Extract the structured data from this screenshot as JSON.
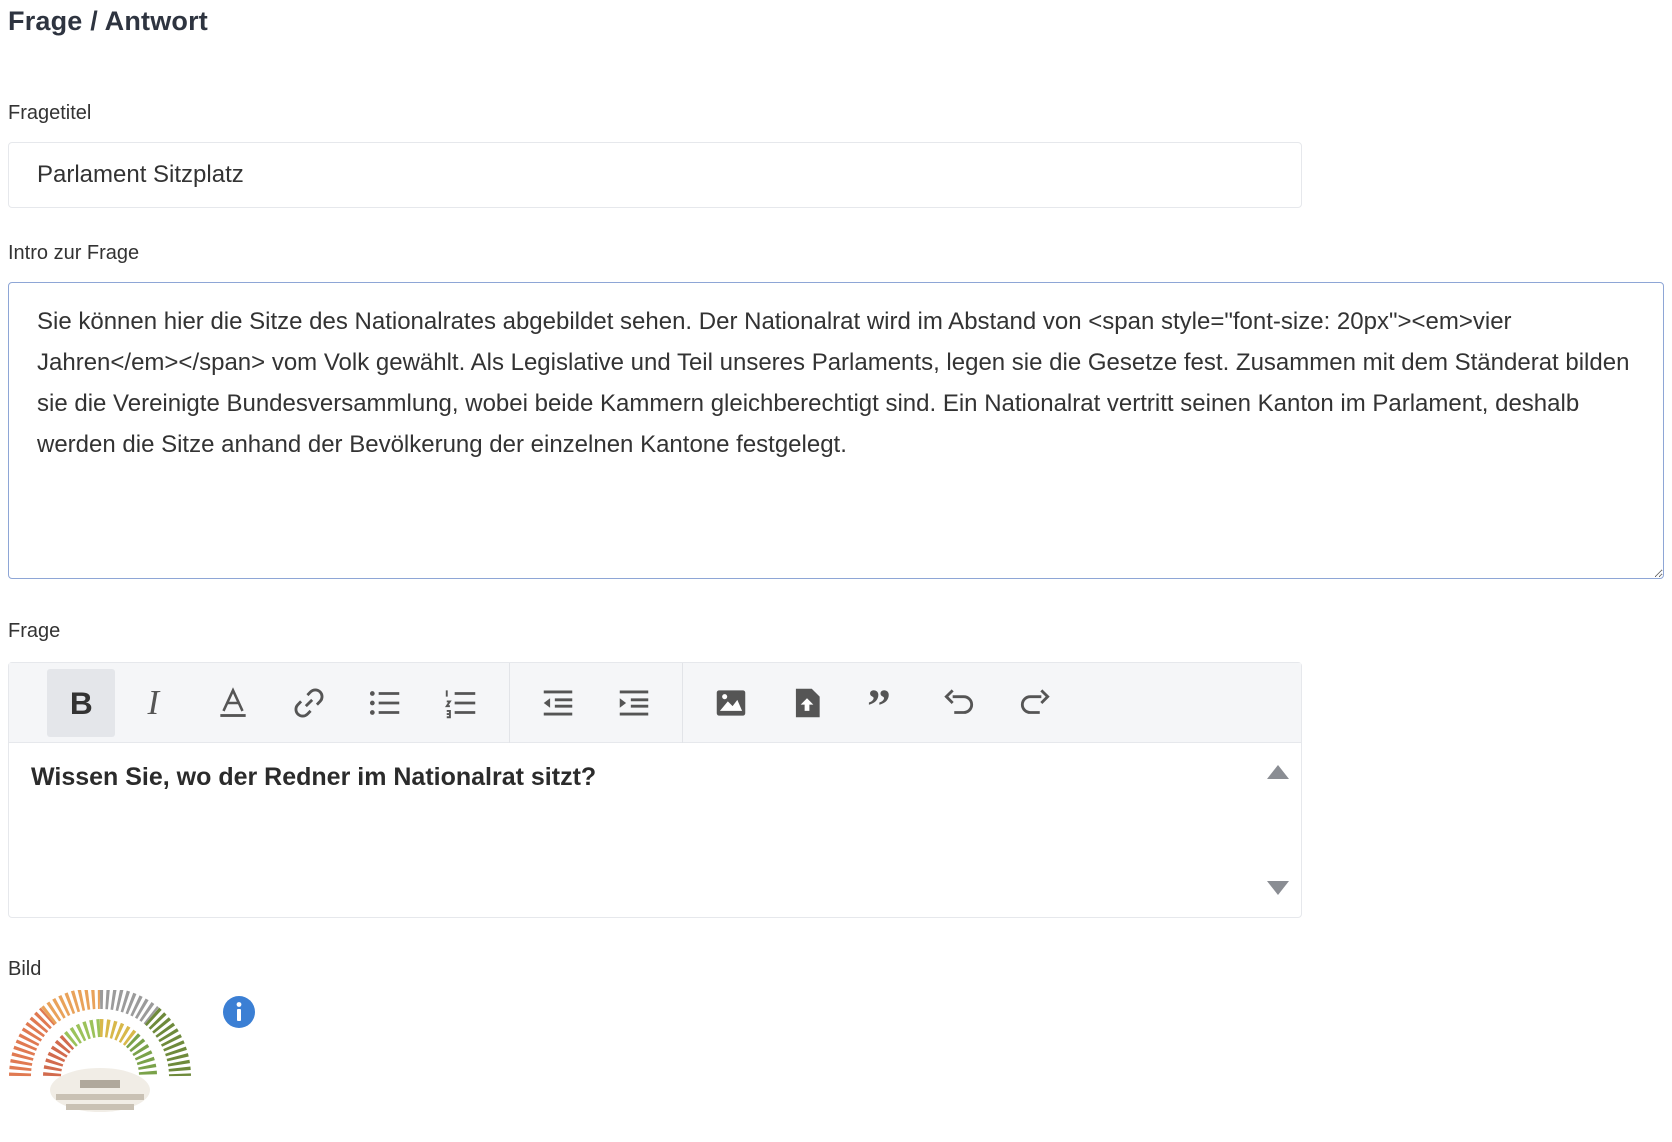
{
  "section": {
    "title": "Frage / Antwort"
  },
  "fragetitel": {
    "label": "Fragetitel",
    "value": "Parlament Sitzplatz"
  },
  "intro": {
    "label": "Intro zur Frage",
    "value": "Sie können hier die Sitze des Nationalrates abgebildet sehen. Der Nationalrat wird im Abstand von <span style=\"font-size: 20px\"><em>vier Jahren</em></span> vom Volk gewählt. Als Legislative und Teil unseres Parlaments, legen sie die Gesetze fest. Zusammen mit dem Ständerat bilden sie die Vereinigte Bundesversammlung, wobei beide Kammern gleichberechtigt sind. Ein Nationalrat vertritt seinen Kanton im Parlament, deshalb werden die Sitze anhand der Bevölkerung der einzelnen Kantone festgelegt."
  },
  "frage": {
    "label": "Frage",
    "content": "Wissen Sie, wo der Redner im Nationalrat sitzt?",
    "toolbar": [
      {
        "name": "bold",
        "icon": "bold-icon",
        "active": true
      },
      {
        "name": "italic",
        "icon": "italic-icon"
      },
      {
        "name": "text-color",
        "icon": "text-color-icon"
      },
      {
        "name": "link",
        "icon": "link-icon"
      },
      {
        "name": "bulleted-list",
        "icon": "bulleted-list-icon"
      },
      {
        "name": "numbered-list",
        "icon": "numbered-list-icon"
      },
      {
        "name": "outdent",
        "icon": "outdent-icon"
      },
      {
        "name": "indent",
        "icon": "indent-icon"
      },
      {
        "name": "insert-image",
        "icon": "image-icon"
      },
      {
        "name": "upload-file",
        "icon": "file-upload-icon"
      },
      {
        "name": "blockquote",
        "icon": "quote-icon"
      },
      {
        "name": "undo",
        "icon": "undo-icon"
      },
      {
        "name": "redo",
        "icon": "redo-icon"
      }
    ]
  },
  "bild": {
    "label": "Bild",
    "info_icon": "info-icon",
    "image": "parliament-seating-thumbnail"
  },
  "colors": {
    "accent": "#3b7fd4",
    "focus_border": "#8ea6d6",
    "toolbar_bg": "#f5f6f8"
  }
}
